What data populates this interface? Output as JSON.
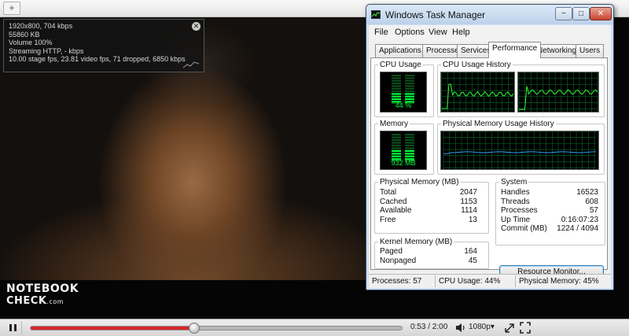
{
  "video": {
    "stats": {
      "line1": "1920x800, 704 kbps",
      "line2": "55860 KB",
      "line3": "Volume 100%",
      "line4": "Streaming HTTP, - kbps",
      "line5": "10.00 stage fps, 23.81 video fps, 71 dropped, 6850 kbps",
      "close_glyph": "✕"
    },
    "logo": {
      "line1": "NOTEBOOK",
      "line2": "CHECK",
      "suffix": ".com"
    }
  },
  "player": {
    "progress": 0.4417,
    "time": "0:53 / 2:00",
    "quality": "1080p",
    "quality_arrow": "▾",
    "colors": {
      "played": "#d9252a",
      "track": "#b7b7b7"
    },
    "icons": [
      "pause-icon",
      "volume-icon",
      "popout-icon",
      "fullscreen-icon"
    ]
  },
  "browser": {
    "tab_glyph": "+"
  },
  "task_manager": {
    "title": "Windows Task Manager",
    "controls": {
      "minimize": "−",
      "maximize": "□",
      "close": "✕"
    },
    "menu": [
      "File",
      "Options",
      "View",
      "Help"
    ],
    "tabs": [
      "Applications",
      "Processes",
      "Services",
      "Performance",
      "Networking",
      "Users"
    ],
    "active_tab": "Performance",
    "cpu": {
      "label": "CPU Usage",
      "value": "44 %",
      "history_label": "CPU Usage History",
      "level": 0.44
    },
    "memory": {
      "label": "Memory",
      "value": "932 MB",
      "history_label": "Physical Memory Usage History",
      "level": 0.45
    },
    "physical_memory": {
      "title": "Physical Memory (MB)",
      "rows": [
        {
          "label": "Total",
          "value": "2047"
        },
        {
          "label": "Cached",
          "value": "1153"
        },
        {
          "label": "Available",
          "value": "1114"
        },
        {
          "label": "Free",
          "value": "13"
        }
      ]
    },
    "kernel_memory": {
      "title": "Kernel Memory (MB)",
      "rows": [
        {
          "label": "Paged",
          "value": "164"
        },
        {
          "label": "Nonpaged",
          "value": "45"
        }
      ]
    },
    "system": {
      "title": "System",
      "rows": [
        {
          "label": "Handles",
          "value": "16523"
        },
        {
          "label": "Threads",
          "value": "608"
        },
        {
          "label": "Processes",
          "value": "57"
        },
        {
          "label": "Up Time",
          "value": "0:16:07:23"
        },
        {
          "label": "Commit (MB)",
          "value": "1224 / 4094"
        }
      ]
    },
    "resource_monitor_button": "Resource Monitor...",
    "status": {
      "processes": "Processes: 57",
      "cpu": "CPU Usage: 44%",
      "memory": "Physical Memory: 45%"
    },
    "colors": {
      "meter_green": "#00ff3c",
      "grid": "#0a6b2e",
      "cpu_line": "#33ff33",
      "mem_line": "#3aa0ff"
    }
  }
}
